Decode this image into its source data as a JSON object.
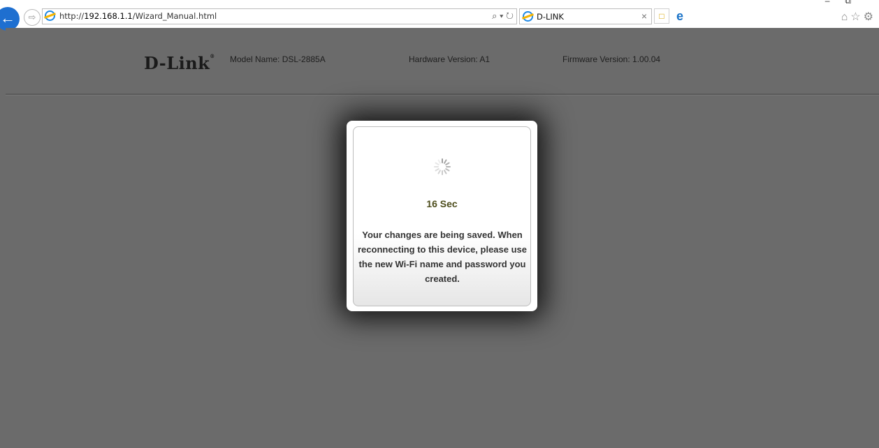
{
  "browser": {
    "url_prefix": "http://",
    "url_host": "192.168.1.1",
    "url_path": "/Wizard_Manual.html",
    "address_tools": "⌕ ▾ ↻",
    "tab_title": "D-LINK",
    "tab_close": "×",
    "right_icons": "⌂☆⚙",
    "window_controls": "–⧉"
  },
  "header": {
    "logo": "D-Link",
    "model": "Model Name: DSL-2885A",
    "hardware": "Hardware Version: A1",
    "firmware": "Firmware Version: 1.00.04"
  },
  "modal": {
    "countdown": "16 Sec",
    "message": "Your changes are being saved. When reconnecting to this device, please use the new Wi-Fi name and password you created."
  },
  "colors": {
    "page_bg": "#6b6b6b",
    "countdown": "#4d4d1c",
    "back_button": "#1e6fd0"
  }
}
